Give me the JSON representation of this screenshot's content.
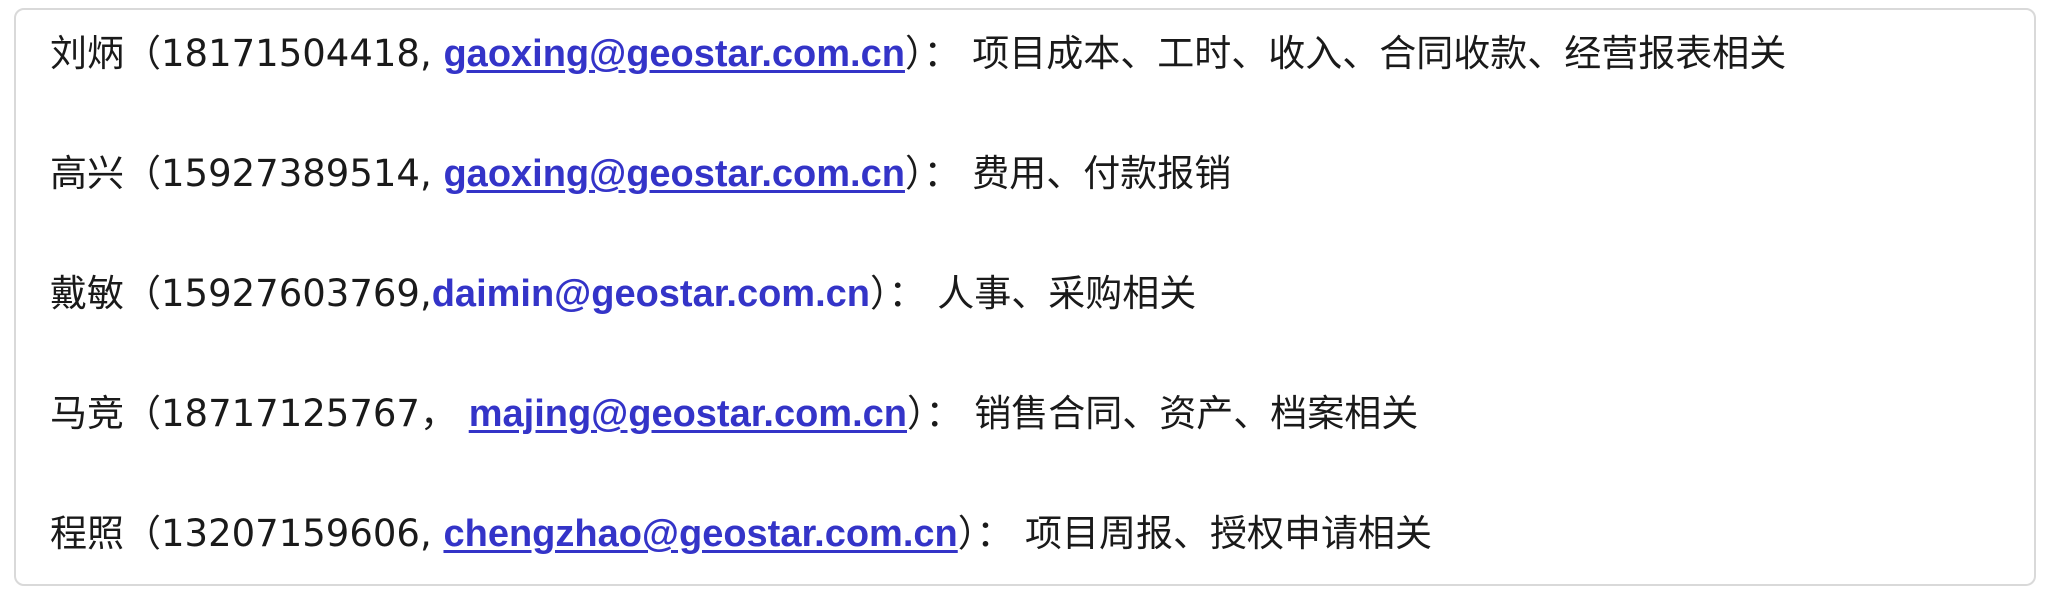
{
  "contacts": [
    {
      "prefix": "刘炳（18171504418, ",
      "email": "gaoxing@geostar.com.cn",
      "suffix": "）： 项目成本、工时、收入、合同收款、经营报表相关"
    },
    {
      "prefix": "高兴（15927389514, ",
      "email": "gaoxing@geostar.com.cn",
      "suffix": "）： 费用、付款报销"
    },
    {
      "prefix": "戴敏（15927603769,",
      "email": "daimin@geostar.com.cn",
      "suffix": "）： 人事、采购相关"
    },
    {
      "prefix": "马竞（18717125767， ",
      "email": "majing@geostar.com.cn",
      "suffix": "）： 销售合同、资产、档案相关"
    },
    {
      "prefix": "程照（13207159606, ",
      "email": "chengzhao@geostar.com.cn",
      "suffix": "）： 项目周报、授权申请相关"
    }
  ]
}
